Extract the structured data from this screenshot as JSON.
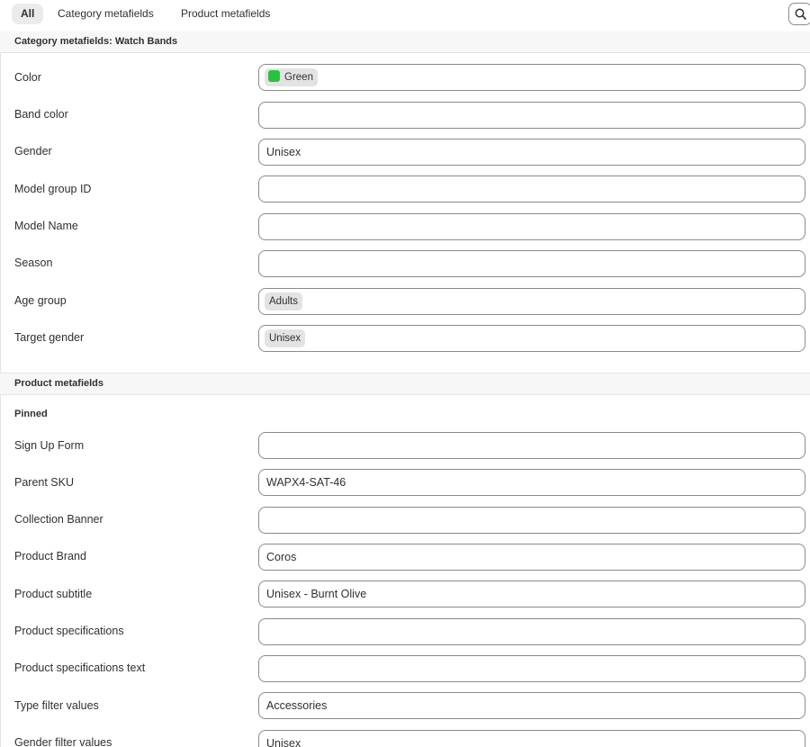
{
  "tabs": [
    {
      "label": "All",
      "active": true
    },
    {
      "label": "Category metafields",
      "active": false
    },
    {
      "label": "Product metafields",
      "active": false
    }
  ],
  "search": {
    "icon": "search-icon"
  },
  "category_section": {
    "title": "Category metafields: Watch Bands",
    "fields": [
      {
        "label": "Color",
        "value": "",
        "chip": "Green",
        "swatch_color": "#29c140"
      },
      {
        "label": "Band color",
        "value": ""
      },
      {
        "label": "Gender",
        "value": "Unisex"
      },
      {
        "label": "Model group ID",
        "value": ""
      },
      {
        "label": "Model Name",
        "value": ""
      },
      {
        "label": "Season",
        "value": ""
      },
      {
        "label": "Age group",
        "value": "",
        "chip": "Adults"
      },
      {
        "label": "Target gender",
        "value": "",
        "chip": "Unisex"
      }
    ]
  },
  "product_section": {
    "title": "Product metafields",
    "subsection": "Pinned",
    "fields": [
      {
        "label": "Sign Up Form",
        "value": ""
      },
      {
        "label": "Parent SKU",
        "value": "WAPX4-SAT-46"
      },
      {
        "label": "Collection Banner",
        "value": ""
      },
      {
        "label": "Product Brand",
        "value": "Coros"
      },
      {
        "label": "Product subtitle",
        "value": "Unisex - Burnt Olive"
      },
      {
        "label": "Product specifications",
        "value": ""
      },
      {
        "label": "Product specifications text",
        "value": ""
      },
      {
        "label": "Type filter values",
        "value": "Accessories"
      },
      {
        "label": "Gender filter values",
        "value": "Unisex"
      }
    ]
  },
  "colors": {
    "border": "#8a8a8a",
    "divider": "#e3e3e3",
    "section_bg": "#f7f7f7",
    "chip_bg": "#e3e3e3",
    "active_tab_bg": "#ebebeb",
    "text": "#303030"
  }
}
